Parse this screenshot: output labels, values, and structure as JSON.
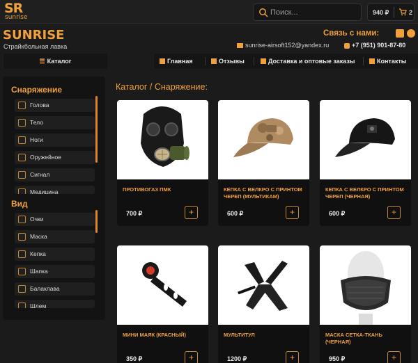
{
  "top": {
    "logo_letters": "SR",
    "logo_small": "sunrise",
    "search_placeholder": "Поиск...",
    "cart_total": "940 ₽",
    "cart_count": "2"
  },
  "header": {
    "brand": "SUNRISE",
    "tagline": "Страйкбольная лавка",
    "contact_title": "Связь с нами:",
    "email": "sunrise-airsoft152@yandex.ru",
    "phone": "+7 (951) 901-87-80"
  },
  "nav": {
    "catalog": "Каталог",
    "items": [
      {
        "label": "Главная",
        "icon": "home-icon"
      },
      {
        "label": "Отзывы",
        "icon": "star-icon"
      },
      {
        "label": "Доставка и оптовые заказы",
        "icon": "map-pin-icon"
      },
      {
        "label": "Контакты",
        "icon": "contact-card-icon"
      }
    ]
  },
  "sidebar": {
    "groups": [
      {
        "title": "Снаряжение",
        "items": [
          "Голова",
          "Тело",
          "Ноги",
          "Оружейное",
          "Сигнал",
          "Медицина"
        ]
      },
      {
        "title": "Вид",
        "items": [
          "Очки",
          "Маска",
          "Кепка",
          "Шапка",
          "Балаклава",
          "Шлем"
        ]
      }
    ]
  },
  "catalog": {
    "breadcrumb": "Каталог / Снаряжение:",
    "products": [
      {
        "name": "ПРОТИВОГАЗ ПМК",
        "price": "700 ₽"
      },
      {
        "name": "КЕПКА С ВЕЛКРО С ПРИНТОМ ЧЕРЕП (МУЛЬТИКАМ)",
        "price": "600 ₽"
      },
      {
        "name": "КЕПКА С ВЕЛКРО С ПРИНТОМ ЧЕРЕП (ЧЕРНАЯ)",
        "price": "600 ₽"
      },
      {
        "name": "МИНИ МАЯК (КРАСНЫЙ)",
        "price": "350 ₽"
      },
      {
        "name": "МУЛЬТИТУЛ",
        "price": "1200 ₽"
      },
      {
        "name": "МАСКА СЕТКА-ТКАНЬ (ЧЕРНАЯ)",
        "price": "950 ₽"
      }
    ],
    "add_label": "+"
  },
  "colors": {
    "accent": "#f0a03c",
    "background": "#1b1b1b",
    "panel": "#131313"
  }
}
